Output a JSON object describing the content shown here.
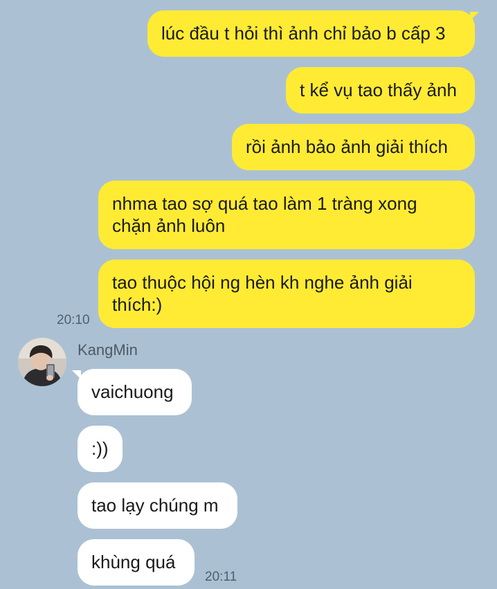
{
  "sent_messages": [
    {
      "text": "lúc đầu t hỏi thì ảnh chỉ bảo b cấp 3"
    },
    {
      "text": "t kể vụ tao thấy ảnh"
    },
    {
      "text": "rồi ảnh bảo ảnh giải thích"
    },
    {
      "text": "nhma tao sợ quá tao làm 1 tràng xong chặn ảnh luôn"
    },
    {
      "text": "tao thuộc hội ng hèn kh nghe ảnh giải thích:)"
    }
  ],
  "sent_time": "20:10",
  "contact": {
    "name": "KangMin"
  },
  "received_messages": [
    {
      "text": "vaichuong"
    },
    {
      "text": ":))"
    },
    {
      "text": "tao lạy chúng m"
    },
    {
      "text": "khùng quá"
    }
  ],
  "received_time": "20:11",
  "colors": {
    "background": "#abc1d3",
    "sent_bubble": "#ffeb34",
    "received_bubble": "#ffffff"
  }
}
